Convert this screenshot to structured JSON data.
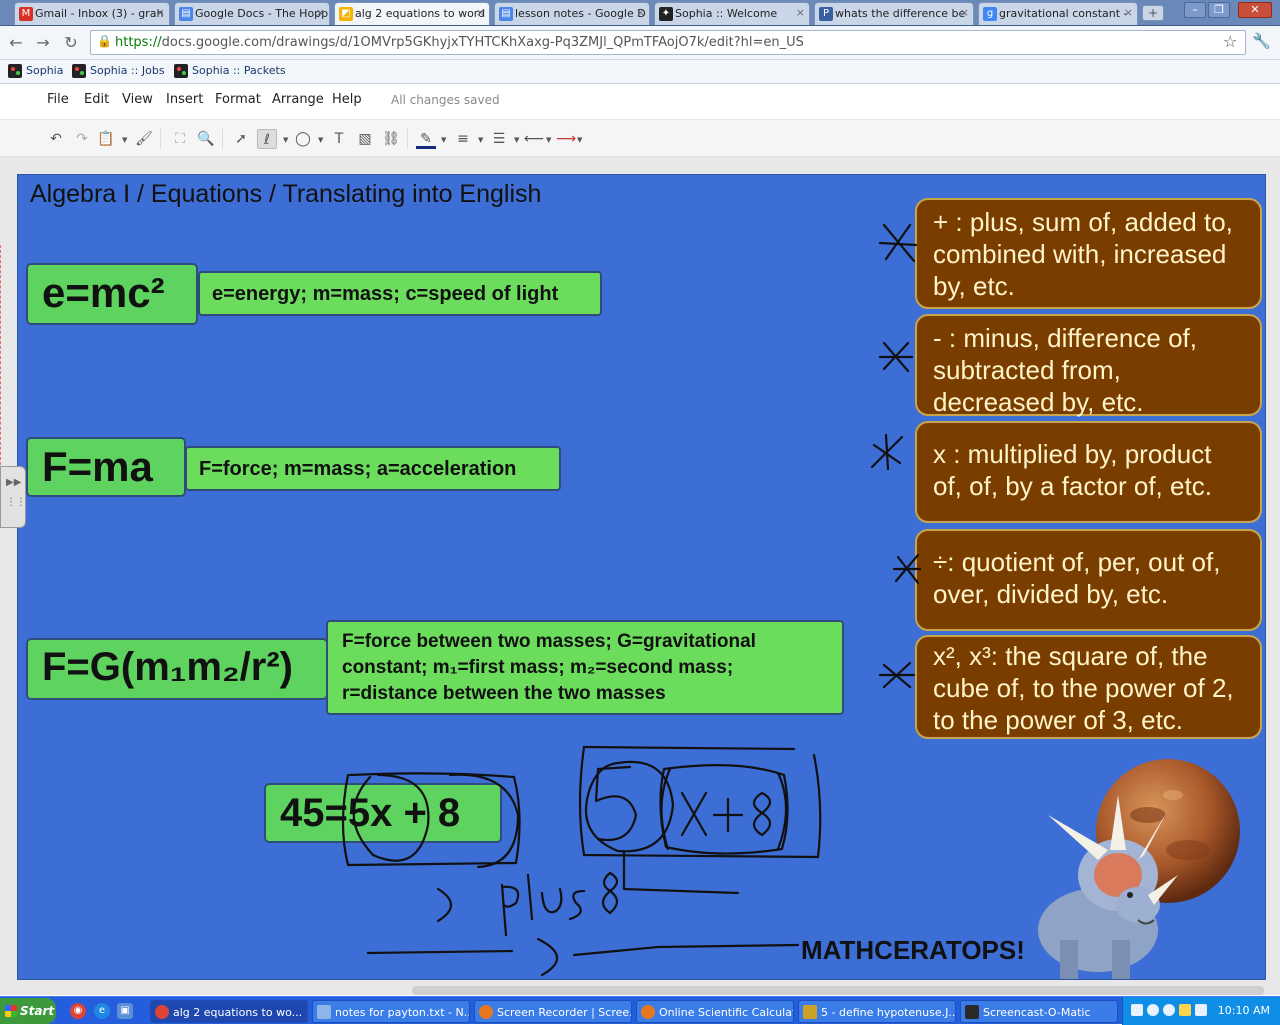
{
  "browser": {
    "tabs": [
      {
        "title": "Gmail - Inbox (3) - grah",
        "icon": "gmail-icon",
        "color": "#d93025"
      },
      {
        "title": "Google Docs - The Hopp",
        "icon": "docs-icon",
        "color": "#4a86e8"
      },
      {
        "title": "alg 2 equations to word",
        "icon": "drawings-icon",
        "color": "#f4b400",
        "active": true
      },
      {
        "title": "lesson notes - Google D",
        "icon": "docs-icon",
        "color": "#4a86e8"
      },
      {
        "title": "Sophia :: Welcome",
        "icon": "sophia-icon",
        "color": "#222222"
      },
      {
        "title": "whats the difference be",
        "icon": "pf-icon",
        "color": "#3a5fa0"
      },
      {
        "title": "gravitational constant -",
        "icon": "google-icon",
        "color": "#4285f4"
      }
    ],
    "url_scheme": "https://",
    "url_rest": "docs.google.com/drawings/d/1OMVrp5GKhyjxTYHTCKhXaxg-Pq3ZMJl_QPmTFAojO7k/edit?hl=en_US",
    "bookmarks": [
      "Sophia",
      "Sophia :: Jobs",
      "Sophia :: Packets"
    ]
  },
  "app": {
    "menu": [
      "File",
      "Edit",
      "View",
      "Insert",
      "Format",
      "Arrange",
      "Help"
    ],
    "save_status": "All changes saved",
    "toolbar_icons": [
      "undo-icon",
      "redo-icon",
      "paste-icon",
      "paint-format-icon",
      "fit-icon",
      "zoom-icon",
      "select-icon",
      "scribble-icon",
      "shape-icon",
      "textbox-icon",
      "image-icon",
      "link-icon",
      "line-color-icon",
      "line-weight-icon",
      "line-dash-icon",
      "line-start-icon",
      "line-end-icon"
    ]
  },
  "slide": {
    "title": "Algebra I / Equations / Translating into English",
    "formulas": [
      {
        "formula": "e=mc²",
        "definition": "e=energy; m=mass; c=speed of light"
      },
      {
        "formula": "F=ma",
        "definition": "F=force; m=mass; a=acceleration"
      },
      {
        "formula": "F=G(m₁m₂/r²)",
        "definition": "F=force between two masses; G=gravitational constant; m₁=first mass; m₂=second mass; r=distance between the two masses"
      }
    ],
    "operations": [
      "+ : plus, sum of, added to, combined with, increased by, etc.",
      "- : minus, difference of, subtracted from, decreased by, etc.",
      "x : multiplied by, product of, of, by a factor of, etc.",
      "÷: quotient of, per, out of, over, divided by, etc.",
      "x², x³: the square of, the cube of, to the power of 2, to the power of 3, etc."
    ],
    "example_equation": "45=5x + 8",
    "handwriting": {
      "expression": "5(x+8)",
      "note": "plus 8"
    },
    "mascot": "MATHCERATOPS!",
    "colors": {
      "background": "#3c6ed6",
      "formula_fill": "#5fd35f",
      "operation_fill": "#7a3d00",
      "operation_text": "#fff3c8"
    }
  },
  "taskbar": {
    "start": "Start",
    "tasks": [
      {
        "label": "alg 2 equations to wo...",
        "active": true
      },
      {
        "label": "notes for payton.txt - N..."
      },
      {
        "label": "Screen Recorder | Scree..."
      },
      {
        "label": "Online Scientific Calculat..."
      },
      {
        "label": "5 - define hypotenuse.J..."
      },
      {
        "label": "Screencast-O-Matic"
      }
    ],
    "clock": "10:10 AM"
  }
}
